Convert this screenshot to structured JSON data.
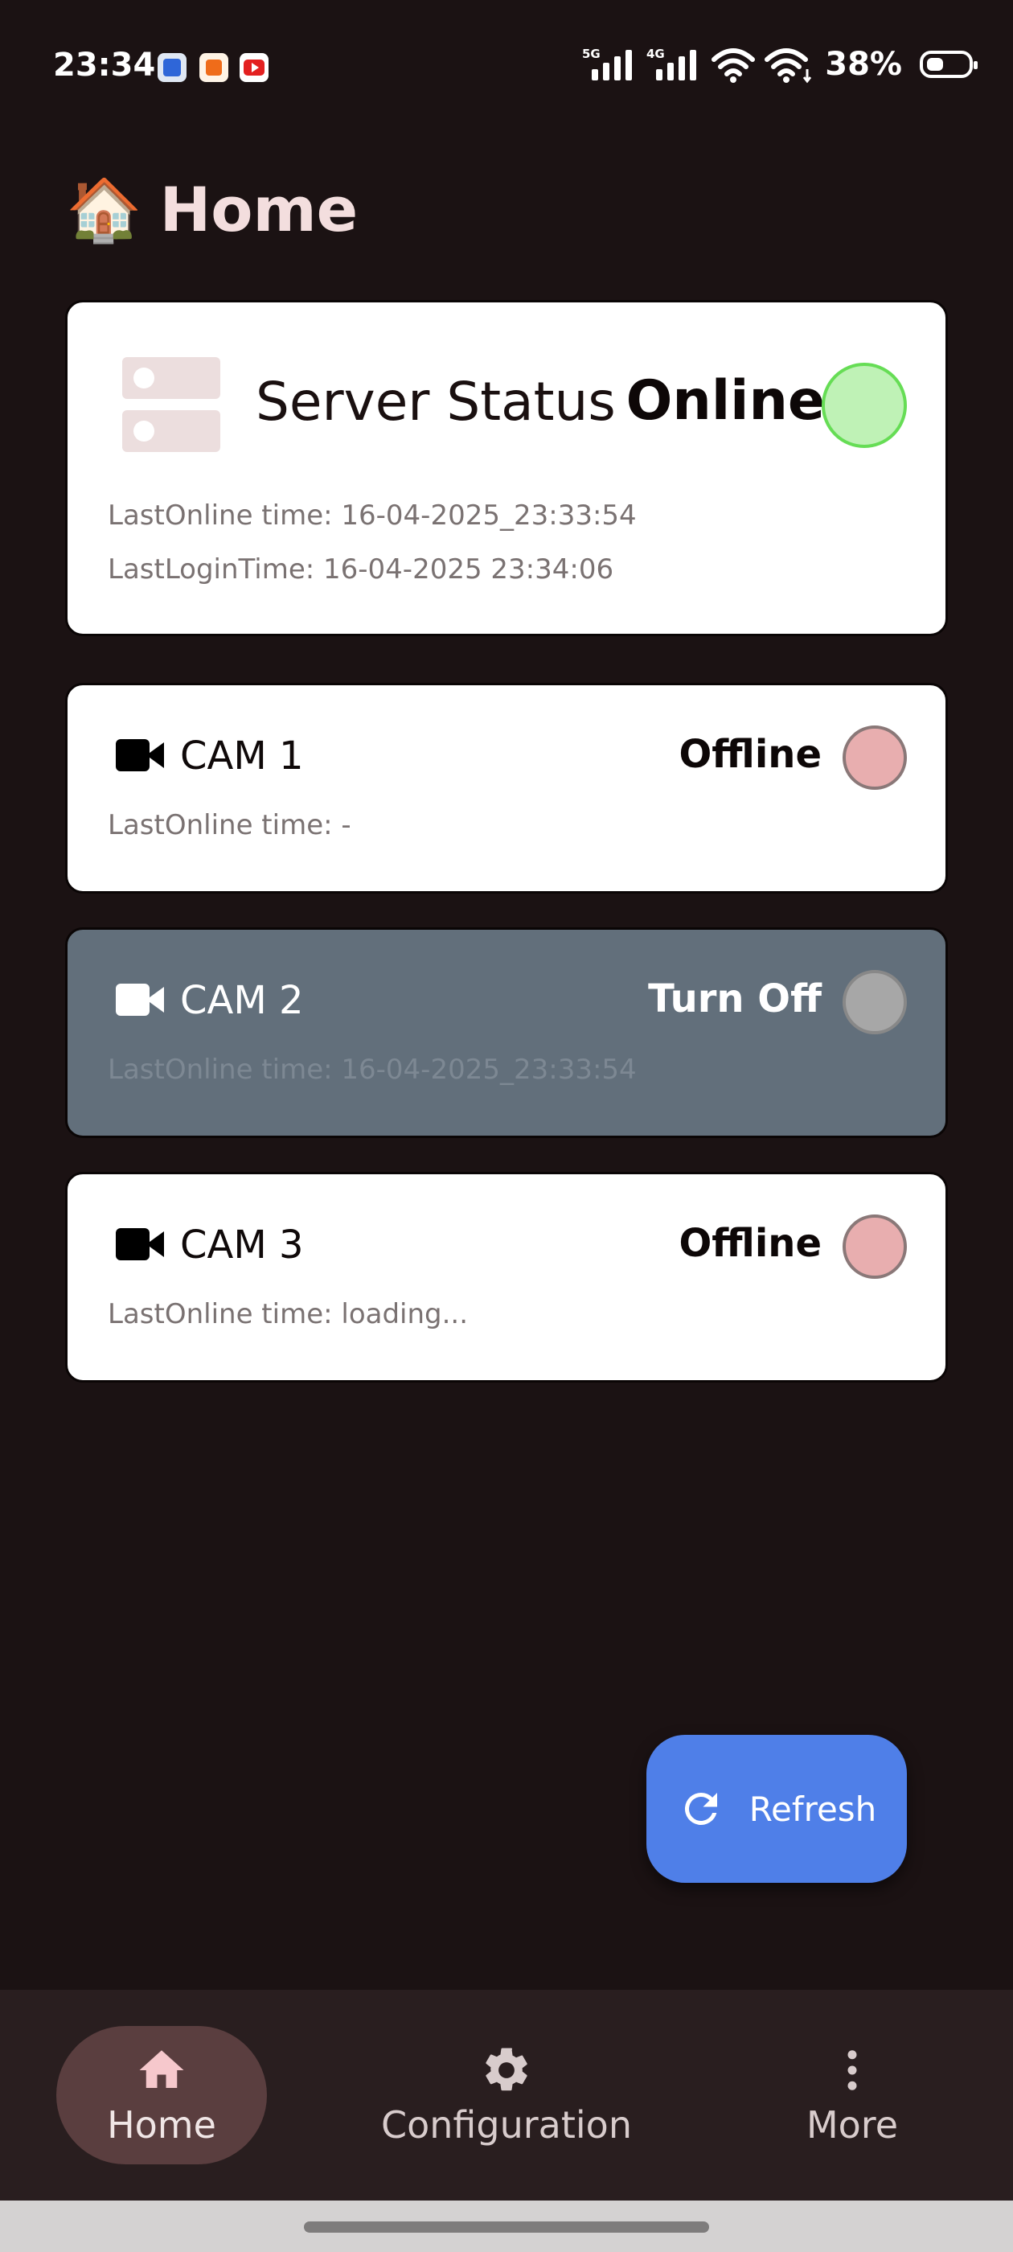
{
  "status_bar": {
    "time": "23:34",
    "notification_icons": [
      "app-icon-blue",
      "app-icon-orange",
      "youtube-icon"
    ],
    "network_labels": [
      "5G",
      "4G"
    ],
    "battery": "38%"
  },
  "page": {
    "icon": "house-emoji",
    "title": "Home"
  },
  "server_card": {
    "title": "Server Status",
    "state": "Online",
    "state_color": "#bff2b6",
    "last_online": "LastOnline time: 16-04-2025_23:33:54",
    "last_login": "LastLoginTime: 16-04-2025 23:34:06"
  },
  "cameras": [
    {
      "label": "CAM 1",
      "state": "Offline",
      "last_online": "LastOnline time: -",
      "state_color": "#e8aeaf"
    },
    {
      "label": "CAM 2",
      "state": "Turn Off",
      "last_online": "LastOnline time: 16-04-2025_23:33:54",
      "state_color": "#a7a7a7",
      "card_color": "#626f7b"
    },
    {
      "label": "CAM 3",
      "state": "Offline",
      "last_online": "LastOnline time: loading...",
      "state_color": "#e8aeaf"
    }
  ],
  "refresh_button": {
    "label": "Refresh",
    "icon": "refresh-icon",
    "color": "#4f7fe8"
  },
  "bottom_nav": {
    "items": [
      {
        "label": "Home",
        "icon": "home-icon",
        "selected": true
      },
      {
        "label": "Configuration",
        "icon": "gear-icon",
        "selected": false
      },
      {
        "label": "More",
        "icon": "more-vertical-icon",
        "selected": false
      }
    ]
  }
}
